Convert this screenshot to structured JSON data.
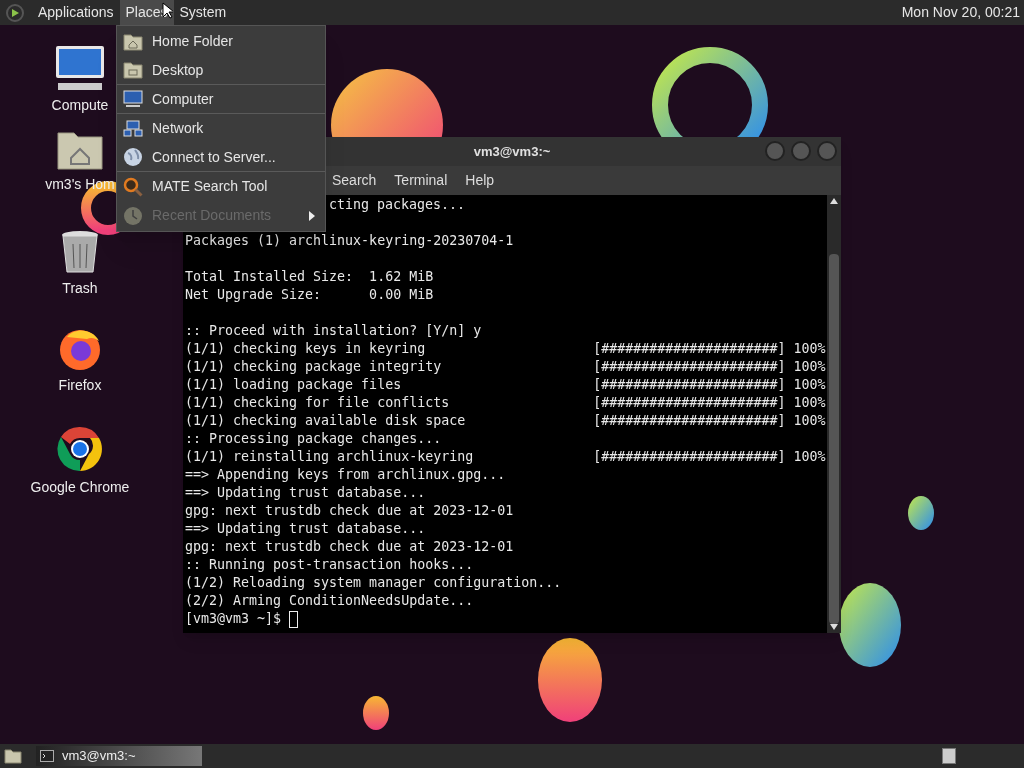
{
  "top_panel": {
    "menus": [
      {
        "label": "Applications",
        "selected": false
      },
      {
        "label": "Places",
        "selected": true
      },
      {
        "label": "System",
        "selected": false
      }
    ],
    "clock": "Mon Nov 20, 00:21"
  },
  "desktop_icons": [
    {
      "kind": "computer",
      "label": "Compute"
    },
    {
      "kind": "home",
      "label": "vm3's Hom"
    },
    {
      "kind": "trash",
      "label": "Trash"
    },
    {
      "kind": "firefox",
      "label": "Firefox"
    },
    {
      "kind": "chrome",
      "label": "Google Chrome"
    }
  ],
  "places_menu": {
    "items": [
      {
        "kind": "home",
        "label": "Home Folder",
        "disabled": false,
        "submenu": false,
        "separator_after": false
      },
      {
        "kind": "desktop",
        "label": "Desktop",
        "disabled": false,
        "submenu": false,
        "separator_after": true
      },
      {
        "kind": "computer",
        "label": "Computer",
        "disabled": false,
        "submenu": false,
        "separator_after": true
      },
      {
        "kind": "network",
        "label": "Network",
        "disabled": false,
        "submenu": false,
        "separator_after": false
      },
      {
        "kind": "globe",
        "label": "Connect to Server...",
        "disabled": false,
        "submenu": false,
        "separator_after": true
      },
      {
        "kind": "search",
        "label": "MATE Search Tool",
        "disabled": false,
        "submenu": false,
        "separator_after": false
      },
      {
        "kind": "clock",
        "label": "Recent Documents",
        "disabled": true,
        "submenu": true,
        "separator_after": false
      }
    ]
  },
  "terminal": {
    "title": "vm3@vm3:~",
    "menu": [
      "Search",
      "Terminal",
      "Help"
    ],
    "lines": [
      {
        "kind": "partial",
        "text": "cting packages..."
      },
      {
        "kind": "blank"
      },
      {
        "kind": "text",
        "text": "Packages (1) archlinux-keyring-20230704-1"
      },
      {
        "kind": "blank"
      },
      {
        "kind": "text",
        "text": "Total Installed Size:  1.62 MiB"
      },
      {
        "kind": "text",
        "text": "Net Upgrade Size:      0.00 MiB"
      },
      {
        "kind": "blank"
      },
      {
        "kind": "text",
        "text": ":: Proceed with installation? [Y/n] y"
      },
      {
        "kind": "text",
        "text": "(1/1) checking keys in keyring                     [######################] 100%"
      },
      {
        "kind": "text",
        "text": "(1/1) checking package integrity                   [######################] 100%"
      },
      {
        "kind": "text",
        "text": "(1/1) loading package files                        [######################] 100%"
      },
      {
        "kind": "text",
        "text": "(1/1) checking for file conflicts                  [######################] 100%"
      },
      {
        "kind": "text",
        "text": "(1/1) checking available disk space                [######################] 100%"
      },
      {
        "kind": "text",
        "text": ":: Processing package changes..."
      },
      {
        "kind": "text",
        "text": "(1/1) reinstalling archlinux-keyring               [######################] 100%"
      },
      {
        "kind": "text",
        "text": "==> Appending keys from archlinux.gpg..."
      },
      {
        "kind": "text",
        "text": "==> Updating trust database..."
      },
      {
        "kind": "text",
        "text": "gpg: next trustdb check due at 2023-12-01"
      },
      {
        "kind": "text",
        "text": "==> Updating trust database..."
      },
      {
        "kind": "text",
        "text": "gpg: next trustdb check due at 2023-12-01"
      },
      {
        "kind": "text",
        "text": ":: Running post-transaction hooks..."
      },
      {
        "kind": "text",
        "text": "(1/2) Reloading system manager configuration..."
      },
      {
        "kind": "text",
        "text": "(2/2) Arming ConditionNeedsUpdate..."
      },
      {
        "kind": "prompt",
        "text": "[vm3@vm3 ~]$ "
      }
    ]
  },
  "taskbar": {
    "tasks": [
      {
        "label": "vm3@vm3:~",
        "selected": true
      }
    ]
  }
}
